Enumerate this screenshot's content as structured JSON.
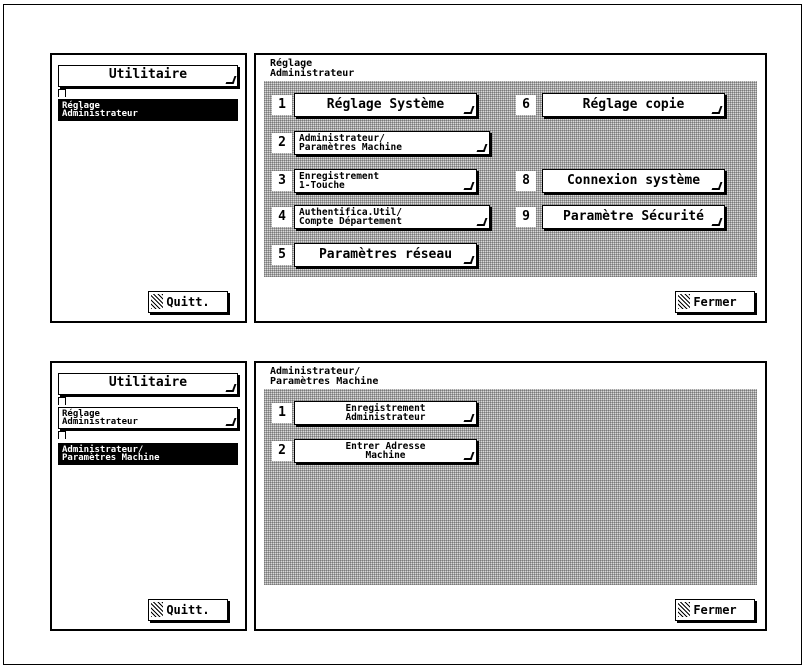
{
  "screen1": {
    "crumbs": [
      "Utilitaire",
      "Réglage\nAdministrateur"
    ],
    "title": "Réglage\nAdministrateur",
    "items": [
      {
        "num": "1",
        "label": "Réglage Système"
      },
      {
        "num": "2",
        "label": "Administrateur/\nParamètres Machine"
      },
      {
        "num": "3",
        "label": "Enregistrement\n1-Touche"
      },
      {
        "num": "4",
        "label": "Authentifica.Util/\nCompte Département"
      },
      {
        "num": "5",
        "label": "Paramètres réseau"
      },
      {
        "num": "6",
        "label": "Réglage copie"
      },
      {
        "num": "8",
        "label": "Connexion système"
      },
      {
        "num": "9",
        "label": "Paramètre Sécurité"
      }
    ],
    "quit_label": "Quitt.",
    "close_label": "Fermer"
  },
  "screen2": {
    "crumbs": [
      "Utilitaire",
      "Réglage\nAdministrateur",
      "Administrateur/\nParamètres Machine"
    ],
    "title": "Administrateur/\nParamètres Machine",
    "items": [
      {
        "num": "1",
        "label": "Enregistrement\nAdministrateur"
      },
      {
        "num": "2",
        "label": "Entrer Adresse\nMachine"
      }
    ],
    "quit_label": "Quitt.",
    "close_label": "Fermer"
  },
  "icons": {
    "button_corner": "corner-mark-icon",
    "quit_hatch": "hatch-icon"
  }
}
